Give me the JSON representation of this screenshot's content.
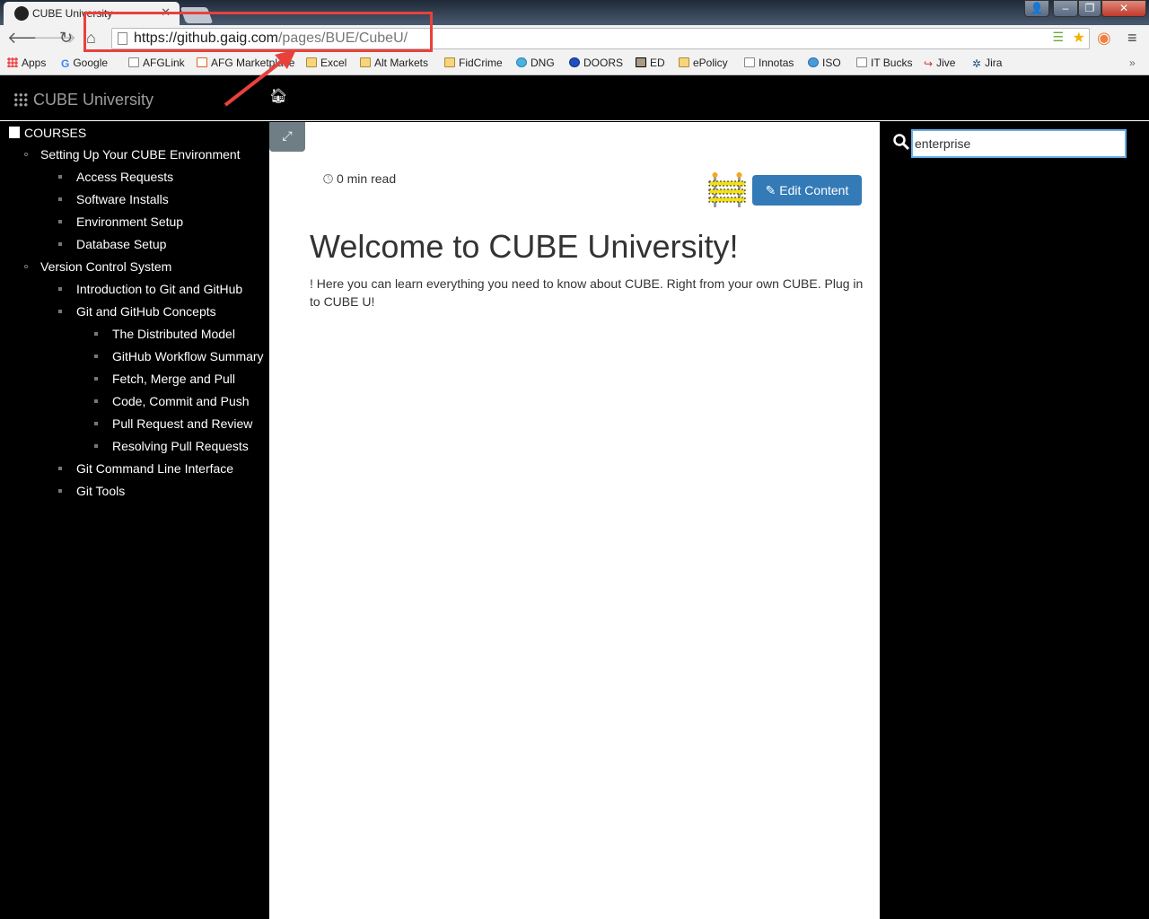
{
  "browser": {
    "tab_title": "CUBE University",
    "url_host": "https://github.gaig.com",
    "url_path": "/pages/BUE/CubeU/",
    "bookmarks": [
      "Apps",
      "Google",
      "AFGLink",
      "AFG Marketplace",
      "Excel",
      "Alt Markets",
      "FidCrime",
      "DNG",
      "DOORS",
      "ED",
      "ePolicy",
      "Innotas",
      "ISO",
      "IT Bucks",
      "Jive",
      "Jira"
    ],
    "annotation_color": "#e8413c"
  },
  "header": {
    "brand": "CUBE University"
  },
  "sidebar": {
    "heading": "COURSES",
    "items": [
      {
        "label": "Setting Up Your CUBE Environment",
        "level": 1
      },
      {
        "label": "Access Requests",
        "level": 2
      },
      {
        "label": "Software Installs",
        "level": 2
      },
      {
        "label": "Environment Setup",
        "level": 2
      },
      {
        "label": "Database Setup",
        "level": 2
      },
      {
        "label": "Version Control System",
        "level": 1
      },
      {
        "label": "Introduction to Git and GitHub",
        "level": 2
      },
      {
        "label": "Git and GitHub Concepts",
        "level": 2
      },
      {
        "label": "The Distributed Model",
        "level": 3
      },
      {
        "label": "GitHub Workflow Summary",
        "level": 3
      },
      {
        "label": "Fetch, Merge and Pull",
        "level": 3
      },
      {
        "label": "Code, Commit and Push",
        "level": 3
      },
      {
        "label": "Pull Request and Review",
        "level": 3
      },
      {
        "label": "Resolving Pull Requests",
        "level": 3
      },
      {
        "label": "Git Command Line Interface",
        "level": 2
      },
      {
        "label": "Git Tools",
        "level": 2
      }
    ]
  },
  "main": {
    "read_time": "0 min read",
    "edit_label": "Edit Content",
    "title": "Welcome to CUBE University!",
    "intro": "! Here you can learn everything you need to know about CUBE. Right from your own CUBE. Plug in to CUBE U!",
    "accent": "#337ab7"
  },
  "search": {
    "value": "enterprise"
  }
}
